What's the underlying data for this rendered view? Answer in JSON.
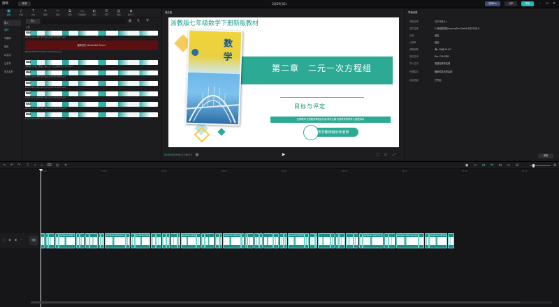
{
  "app": {
    "name": "剪映",
    "menu_label": "菜单",
    "project_title": "2月29日(1)",
    "buttons": {
      "pro": "剪映Pro",
      "share": "分享",
      "export": "导出"
    }
  },
  "toolbar": {
    "items": [
      {
        "icon": "▣",
        "label": "媒体"
      },
      {
        "icon": "♪",
        "label": "音频"
      },
      {
        "icon": "T",
        "label": "文本"
      },
      {
        "icon": "✦",
        "label": "贴纸"
      },
      {
        "icon": "✧",
        "label": "特效"
      },
      {
        "icon": "⧉",
        "label": "转场"
      },
      {
        "icon": "▭",
        "label": "字幕模板"
      },
      {
        "icon": "◐",
        "label": "滤镜"
      },
      {
        "icon": "☰",
        "label": "调节"
      },
      {
        "icon": "▤",
        "label": "模板"
      },
      {
        "icon": "◆",
        "label": "数字人"
      }
    ]
  },
  "leftnav": {
    "items": [
      "导入",
      "素材",
      "字幕库",
      "我的",
      "AI生成",
      "云素材",
      "官方素材"
    ]
  },
  "media": {
    "import_label": "导入",
    "section_label": "全部",
    "items": [
      {
        "name": "bandicam 2023-02-19 14-48-33-302.mp4",
        "dur": "4:33"
      },
      {
        "name": "BDCD9F0F8C7D0A8C-6F7D01FE.png",
        "dur": ""
      },
      {
        "name": "浙教版七年级下册第二章二元一次方程组复习_01.mp4",
        "dur": "2:11"
      },
      {
        "name": "bandicam 2023-02-19 14-49-07-204.mp4",
        "dur": "1:05"
      },
      {
        "name": "bandicam 2023-02-19 14-50-11-008.mp4",
        "dur": "2:40"
      },
      {
        "name": "bandicam 2023-02-19 14-51-02-812.mp4",
        "dur": "3:12"
      },
      {
        "name": "bandicam 2023-02-19 14-52-38-116.mp4",
        "dur": "0:58"
      },
      {
        "name": "bandicam 2023-02-19 14-53-44-620.mp4",
        "dur": "4:01"
      }
    ],
    "not_found": "媒体丢失 Media Not Found"
  },
  "player": {
    "title": "播放器",
    "time_current": "00:00:00:00",
    "time_total": "01:27:40:13",
    "slide": {
      "title": "浙教版七年级数学下册新版教材",
      "book_brand": "数学",
      "chapter": "第二章　二元一次方程组",
      "subtitle": "目标与评定",
      "info": "优秀教师·优质教育课程创作者·教学主编·资深教育指导师·心理咨询师",
      "author": "数学教研组长朱老师"
    },
    "slide_tools": [
      "❯",
      "⁄",
      "⁄",
      "⁄",
      "⁄",
      "⁄",
      "⁄",
      "⁄",
      "⁄",
      "⁄",
      "⌫",
      "✥",
      "✎",
      "◉",
      "◙",
      "⟲",
      "▯",
      "✕"
    ]
  },
  "props": {
    "title": "草稿参数",
    "rows": [
      {
        "k": "草稿名称",
        "v": "2月29日(1)"
      },
      {
        "k": "保存位置",
        "v": "E:/新建剪辑/JianyingPro Drafts/2月29日(1)"
      },
      {
        "k": "比例",
        "v": "适应"
      },
      {
        "k": "分辨率",
        "v": "适应"
      },
      {
        "k": "草稿帧率",
        "v": "每s 30帧 30.00"
      },
      {
        "k": "颜色空间",
        "v": "Rec.709 SDR"
      },
      {
        "k": "导入方式",
        "v": "保留在原有位置"
      },
      {
        "k": "代理模式",
        "v": "播放和导出时启用"
      },
      {
        "k": "自由层级",
        "v": "已开启"
      }
    ],
    "edit_label": "修改"
  },
  "timeline": {
    "cover_label": "封面",
    "ticks": [
      "00:00",
      "10:00",
      "20:00",
      "30:00",
      "40:00",
      "50:00",
      "60:00",
      "70:00",
      "80:00"
    ],
    "clip_label": "bandicam 2023-02-19 14-"
  },
  "colors": {
    "accent": "#2fd0d0",
    "slide_teal": "#2daa94",
    "clip": "#1f8f8a",
    "error_bg": "#5a1010"
  }
}
